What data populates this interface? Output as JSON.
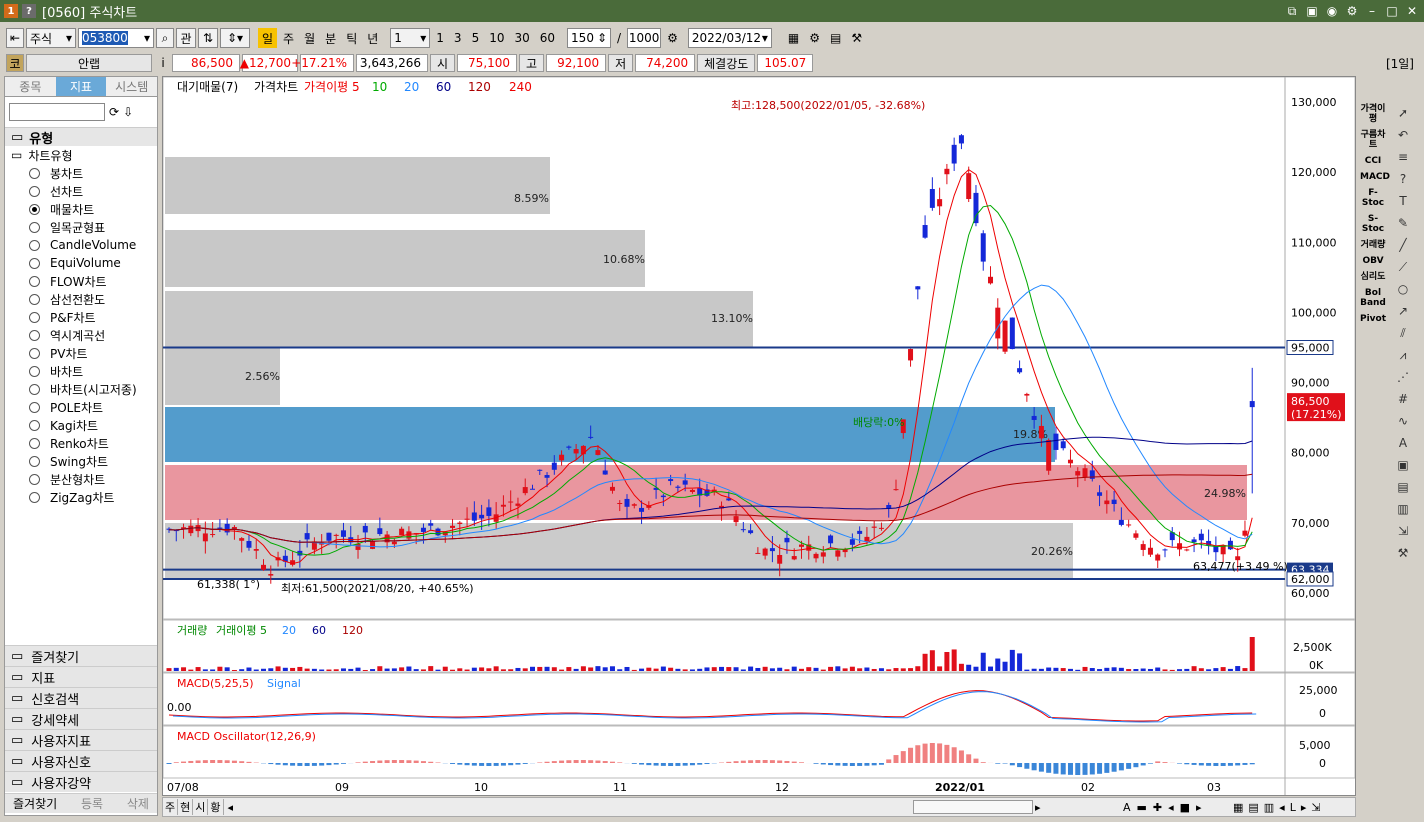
{
  "window": {
    "title": "[0560] 주식차트",
    "icons": [
      "1",
      "?"
    ]
  },
  "toolbar": {
    "market": "주식",
    "code": "053800",
    "buttons": [
      "관"
    ],
    "periods": [
      "일",
      "주",
      "월",
      "분",
      "틱",
      "년"
    ],
    "period_sel": "1",
    "quick": [
      "1",
      "3",
      "5",
      "10",
      "30",
      "60"
    ],
    "count": "150",
    "slash": "/",
    "total": "1000",
    "date": "2022/03/12"
  },
  "info": {
    "label": "코",
    "name": "안랩",
    "price": "86,500",
    "change": "▲12,700",
    "rate": "+17.21%",
    "volume": "3,643,266",
    "open_l": "시",
    "open": "75,100",
    "high_l": "고",
    "high": "92,100",
    "low_l": "저",
    "low": "74,200",
    "str_l": "체결강도",
    "str": "105.07",
    "period": "[1일]",
    "i": "i"
  },
  "left": {
    "tabs": [
      "종목",
      "지표",
      "시스템"
    ],
    "section": "유형",
    "group": "차트유형",
    "items": [
      "봉차트",
      "선차트",
      "매물차트",
      "일목균형표",
      "CandleVolume",
      "EquiVolume",
      "FLOW차트",
      "삼선전환도",
      "P&F차트",
      "역시계곡선",
      "PV차트",
      "바차트",
      "바차트(시고저종)",
      "POLE차트",
      "Kagi차트",
      "Renko차트",
      "Swing차트",
      "분산형차트",
      "ZigZag차트"
    ],
    "selected": 2,
    "folders": [
      "즐겨찾기",
      "지표",
      "신호검색",
      "강세약세",
      "사용자지표",
      "사용자신호",
      "사용자강약"
    ],
    "footer": [
      "즐겨찾기",
      "등록",
      "삭제"
    ]
  },
  "chart": {
    "legend": [
      "대기매물(7)",
      "가격차트",
      "가격이평 5",
      "10",
      "20",
      "60",
      "120",
      "240"
    ],
    "legend_colors": [
      "#000",
      "#000",
      "#e00",
      "#0a0",
      "#28f",
      "#008",
      "#a00",
      "#e00"
    ],
    "yaxis": [
      "130,000",
      "120,000",
      "110,000",
      "100,000",
      "90,000",
      "80,000",
      "70,000",
      "60,000"
    ],
    "profile_pct": [
      "8.59%",
      "10.68%",
      "13.10%",
      "2.56%",
      "19.8%",
      "24.98%",
      "20.26%"
    ],
    "max_note": "최고:128,500(2022/01/05, -32.68%)",
    "min_note": "최저:61,500(2021/08/20, +40.65%)",
    "left_note": "61,338(   1°)",
    "div_note": "배당락:0%",
    "last_note": "63,477(+3.49 %)",
    "lbl_95000": "95,000",
    "lbl_63334": "63,334",
    "lbl_62000": "62,000",
    "cur_price": "86,500",
    "cur_rate": "(17.21%)",
    "vol_legend": [
      "거래량",
      "거래이평 5",
      "20",
      "60",
      "120"
    ],
    "vol_axis": [
      "2,500K",
      "0K"
    ],
    "macd_legend": [
      "MACD(5,25,5)",
      "Signal"
    ],
    "macd_zero": "0.00",
    "macd_axis": [
      "25,000",
      "0"
    ],
    "osc_legend": "MACD Oscillator(12,26,9)",
    "osc_axis": [
      "5,000",
      "0"
    ],
    "xaxis": [
      "07/08",
      "09",
      "10",
      "11",
      "12",
      "2022/01",
      "02",
      "03"
    ]
  },
  "right_labels": [
    "가격이평",
    "구름차트",
    "CCI",
    "MACD",
    "F-Stoc",
    "S-Stoc",
    "거래량",
    "OBV",
    "심리도",
    "Bol Band",
    "Pivot"
  ],
  "scroll": {
    "tabs": [
      "주",
      "현",
      "시",
      "황"
    ]
  }
}
